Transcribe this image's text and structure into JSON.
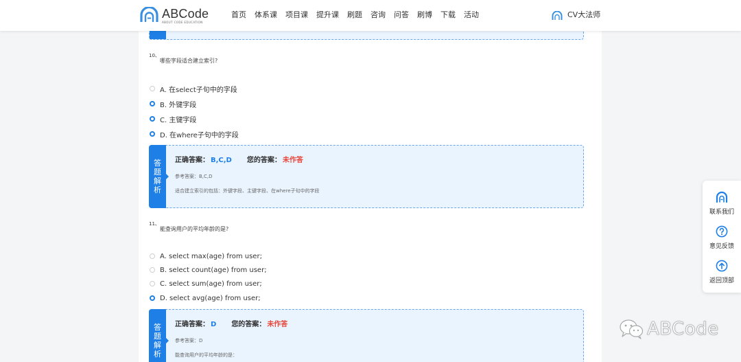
{
  "header": {
    "logo_title": "ABCode",
    "logo_sub": "ABOUT CODE EDUCATION",
    "nav": [
      "首页",
      "体系课",
      "项目课",
      "提升课",
      "刷题",
      "咨询",
      "问答",
      "刷博",
      "下载",
      "活动"
    ],
    "user_name": "CV大法师"
  },
  "questions": [
    {
      "number": "10、",
      "text": "哪些字段适合建立索引?",
      "options": [
        {
          "label": "A. 在select子句中的字段",
          "checked": false
        },
        {
          "label": "B. 外键字段",
          "checked": true
        },
        {
          "label": "C. 主键字段",
          "checked": true
        },
        {
          "label": "D. 在where子句中的字段",
          "checked": true
        }
      ],
      "analysis": {
        "side_label": [
          "答",
          "题",
          "解",
          "析"
        ],
        "correct_key": "正确答案：",
        "correct_value": "B,C,D",
        "yours_key": "您的答案：",
        "yours_value": "未作答",
        "reference": "参考答案：B,C,D",
        "explanation": "适合建立索引的包括：外键字段、主键字段、在where子句中的字段"
      }
    },
    {
      "number": "11、",
      "text": "能查询用户的平均年龄的是?",
      "options": [
        {
          "label": "A. select max(age) from user;",
          "checked": false
        },
        {
          "label": "B. select count(age) from user;",
          "checked": false
        },
        {
          "label": "C. select sum(age) from user;",
          "checked": false
        },
        {
          "label": "D. select avg(age) from user;",
          "checked": true
        }
      ],
      "analysis": {
        "side_label": [
          "答",
          "题",
          "解",
          "析"
        ],
        "correct_key": "正确答案：",
        "correct_value": "D",
        "yours_key": "您的答案：",
        "yours_value": "未作答",
        "reference": "参考答案：D",
        "explanation": "能查询用户的平均年龄的是："
      }
    }
  ],
  "float_bar": [
    {
      "label": "联系我们",
      "icon": "abcode-logo-icon"
    },
    {
      "label": "意见反馈",
      "icon": "question-circle-icon"
    },
    {
      "label": "返回顶部",
      "icon": "arrow-up-circle-icon"
    }
  ],
  "watermark": {
    "text": "ABCode",
    "icon": "wechat-icon"
  },
  "colors": {
    "accent": "#1e7fe6",
    "wrong": "#e8483b",
    "box_bg": "#eaf4ff"
  }
}
